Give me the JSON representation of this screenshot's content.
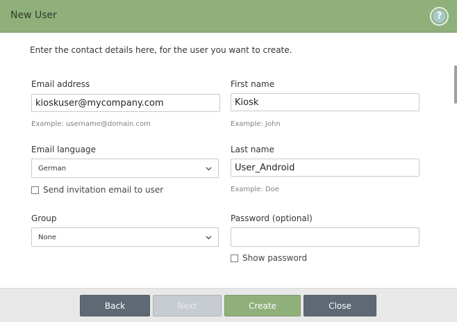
{
  "dialog": {
    "title": "New User",
    "help_icon": "question-icon",
    "help_glyph": "?"
  },
  "form": {
    "intro": "Enter the contact details here, for the user you want to create.",
    "email": {
      "label": "Email address",
      "value": "kioskuser@mycompany.com",
      "hint": "Example: username@domain.com"
    },
    "first_name": {
      "label": "First name",
      "value": "Kiosk",
      "hint": "Example: John"
    },
    "email_language": {
      "label": "Email language",
      "selected": "German"
    },
    "last_name": {
      "label": "Last name",
      "value": "User_Android",
      "hint": "Example: Doe"
    },
    "send_invitation": {
      "label": "Send invitation email to user",
      "checked": false
    },
    "group": {
      "label": "Group",
      "selected": "None"
    },
    "password": {
      "label": "Password (optional)",
      "value": ""
    },
    "show_password": {
      "label": "Show password",
      "checked": false
    }
  },
  "footer": {
    "back_label": "Back",
    "next_label": "Next",
    "create_label": "Create",
    "close_label": "Close"
  },
  "colors": {
    "header": "#8fb07a",
    "button_dark": "#5e6974",
    "button_disabled": "#c6ccd2",
    "button_create": "#8fb07a",
    "footer": "#e8e8e8"
  }
}
